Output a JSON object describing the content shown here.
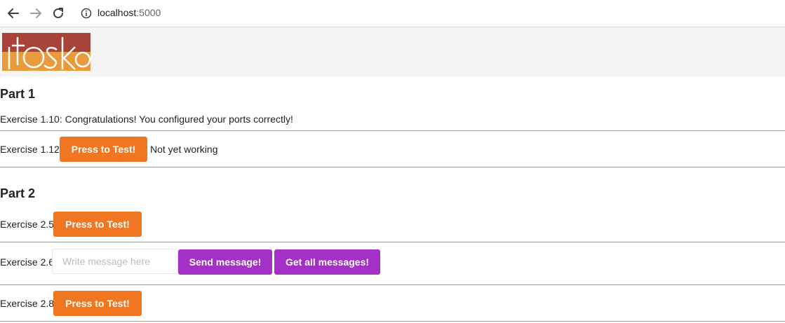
{
  "browser": {
    "host": "localhost",
    "port": ":5000"
  },
  "logo": {
    "text": "itoska",
    "colors": {
      "top": "#a8433a",
      "bottom": "#e89a3c"
    }
  },
  "part1": {
    "heading": "Part 1",
    "ex110": {
      "text": "Exercise 1.10: Congratulations! You configured your ports correctly!"
    },
    "ex112": {
      "label": "Exercise 1.12:",
      "button": "Press to Test!",
      "status": "Not yet working"
    }
  },
  "part2": {
    "heading": "Part 2",
    "ex25": {
      "label": "Exercise 2.5:",
      "button": "Press to Test!"
    },
    "ex26": {
      "label": "Exercise 2.6:",
      "input_value": "",
      "input_placeholder": "Write message here",
      "send_button": "Send message!",
      "get_button": "Get all messages!"
    },
    "ex28": {
      "label": "Exercise 2.8:",
      "button": "Press to Test!"
    }
  },
  "colors": {
    "orange_button": "#f07621",
    "purple_button": "#a530c8"
  }
}
